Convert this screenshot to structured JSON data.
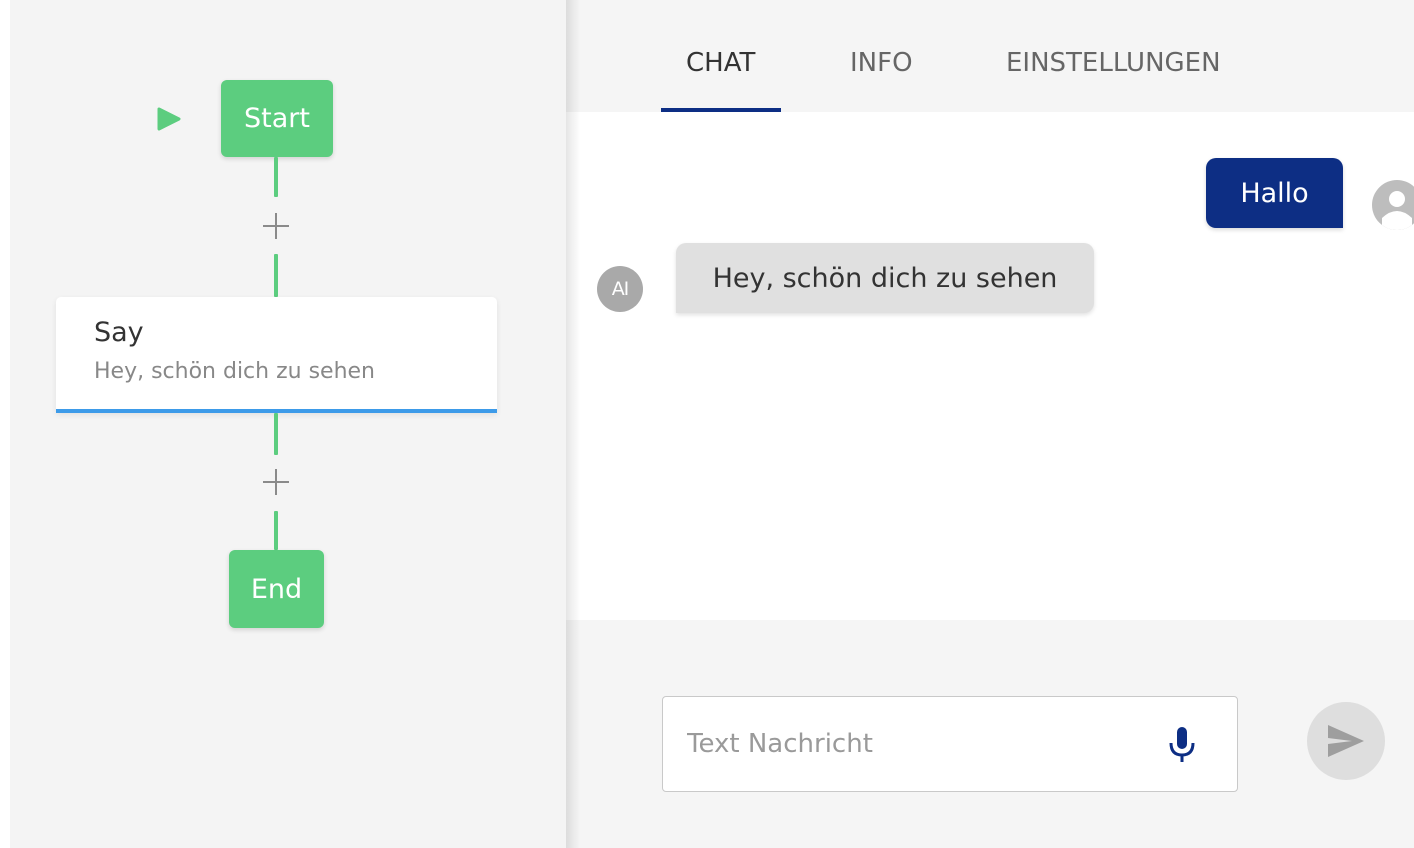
{
  "flow": {
    "start_label": "Start",
    "say_node": {
      "title": "Say",
      "subtitle": "Hey, schön dich zu sehen"
    },
    "end_label": "End",
    "node_color": "#5ccd7f",
    "selected_color": "#3d9be9"
  },
  "chat": {
    "tabs": [
      {
        "label": "CHAT",
        "active": true
      },
      {
        "label": "INFO",
        "active": false
      },
      {
        "label": "EINSTELLUNGEN",
        "active": false
      }
    ],
    "messages": [
      {
        "from": "user",
        "text": "Hallo"
      },
      {
        "from": "bot",
        "text": "Hey, schön dich zu sehen",
        "avatar_text": "AI"
      }
    ],
    "input": {
      "placeholder": "Text Nachricht",
      "value": ""
    },
    "accent_color": "#0d2e84",
    "icons": [
      "play-icon",
      "plus-icon",
      "user-avatar-icon",
      "microphone-icon",
      "send-icon"
    ]
  }
}
